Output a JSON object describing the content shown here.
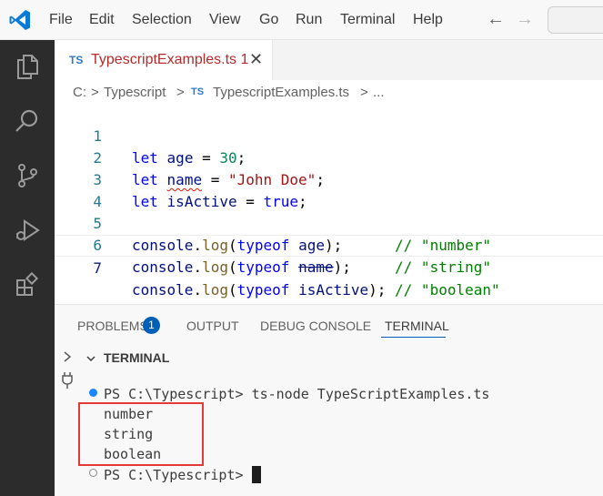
{
  "menubar": {
    "items": [
      "File",
      "Edit",
      "Selection",
      "View",
      "Go",
      "Run",
      "Terminal",
      "Help"
    ],
    "back_arrow": "←",
    "forward_arrow": "→"
  },
  "activity_icons": [
    "explorer-icon",
    "search-icon",
    "source-control-icon",
    "run-debug-icon",
    "extensions-icon"
  ],
  "tab": {
    "badge": "TS",
    "title": "TypescriptExamples.ts",
    "problem_count": "1",
    "close": "✕"
  },
  "breadcrumb": {
    "drive": "C:",
    "sep": ">",
    "folder": "Typescript",
    "badge": "TS",
    "file": "TypescriptExamples.ts",
    "more": "..."
  },
  "editor": {
    "line_numbers": [
      "1",
      "2",
      "3",
      "4",
      "5",
      "6",
      "7"
    ],
    "line1": {
      "kw": "let",
      "var": "age",
      "op": " = ",
      "val": "30",
      "end": ";"
    },
    "line2": {
      "kw": "let",
      "var": "name",
      "op": " = ",
      "val": "\"John Doe\"",
      "end": ";"
    },
    "line3": {
      "kw": "let",
      "var": "isActive",
      "op": " = ",
      "val": "true",
      "end": ";"
    },
    "line5": {
      "obj": "console",
      "dot": ".",
      "fn": "log",
      "open": "(",
      "kw": "typeof",
      "arg": "age",
      "close": ");",
      "pad": "      ",
      "comment": "// \"number\""
    },
    "line6": {
      "obj": "console",
      "dot": ".",
      "fn": "log",
      "open": "(",
      "kw": "typeof",
      "arg": "name",
      "close": ");",
      "pad": "     ",
      "comment": "// \"string\""
    },
    "line7": {
      "obj": "console",
      "dot": ".",
      "fn": "log",
      "open": "(",
      "kw": "typeof",
      "arg": "isActive",
      "close": ");",
      "pad": " ",
      "comment": "// \"boolean\""
    }
  },
  "panel": {
    "tabs": [
      "PROBLEMS",
      "OUTPUT",
      "DEBUG CONSOLE",
      "TERMINAL"
    ],
    "problems_badge": "1",
    "active_tab": "TERMINAL"
  },
  "terminal": {
    "header": "TERMINAL",
    "prompt": "PS C:\\Typescript>",
    "command": "ts-node TypeScriptExamples.ts",
    "output": [
      "number",
      "string",
      "boolean"
    ]
  },
  "colors": {
    "accent": "#005fb8",
    "ts_blue": "#3178c6",
    "highlight": "#e53935",
    "activity_bar": "#2c2c2c"
  }
}
